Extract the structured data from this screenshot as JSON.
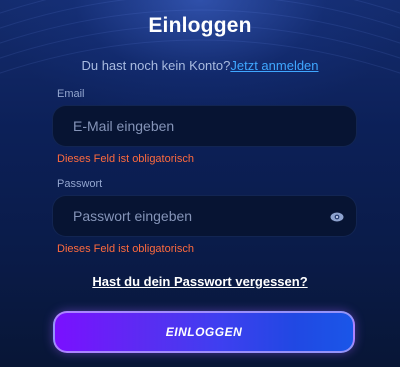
{
  "login": {
    "title": "Einloggen",
    "signup_prompt": "Du hast noch kein Konto?",
    "signup_link": "Jetzt anmelden",
    "email": {
      "label": "Email",
      "placeholder": "E-Mail eingeben",
      "value": "",
      "error": "Dieses Feld ist obligatorisch"
    },
    "password": {
      "label": "Passwort",
      "placeholder": "Passwort eingeben",
      "value": "",
      "error": "Dieses Feld ist obligatorisch",
      "toggle_icon": "eye-icon"
    },
    "forgot_password": "Hast du dein Passwort vergessen?",
    "submit_label": "EINLOGGEN"
  },
  "colors": {
    "background": "#0c2058",
    "input_background": "#071433",
    "link": "#3fa7ff",
    "error": "#ff6a3d",
    "button_gradient_start": "#7a10ff",
    "button_gradient_end": "#1a56e8"
  }
}
